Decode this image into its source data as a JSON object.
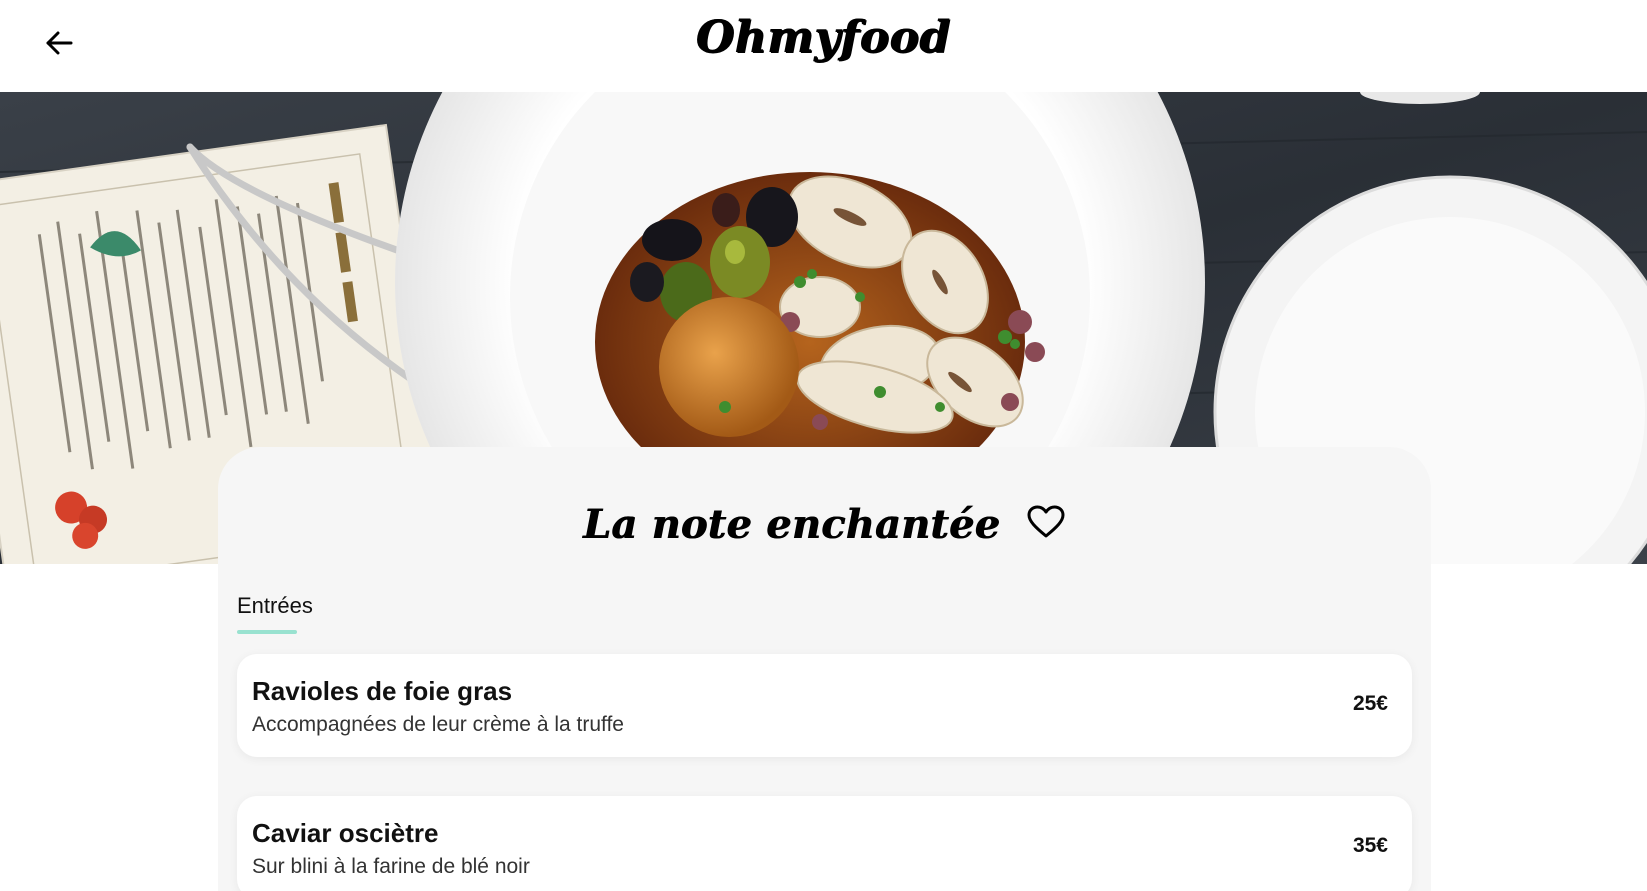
{
  "header": {
    "back_icon": "arrow-left-icon",
    "logo": "Ohmyfood"
  },
  "hero": {
    "image": "restaurant-table-photo"
  },
  "restaurant": {
    "name": "La note enchantée",
    "favorite_icon": "heart-outline-icon"
  },
  "menu": {
    "section_label": "Entrées",
    "accent_color": "#99e2d0",
    "dishes": [
      {
        "name": "Ravioles de foie gras",
        "description": "Accompagnées de leur crème à la truffe",
        "price": "25€"
      },
      {
        "name": "Caviar osciètre",
        "description": "Sur blini à la farine de blé noir",
        "price": "35€"
      }
    ]
  }
}
